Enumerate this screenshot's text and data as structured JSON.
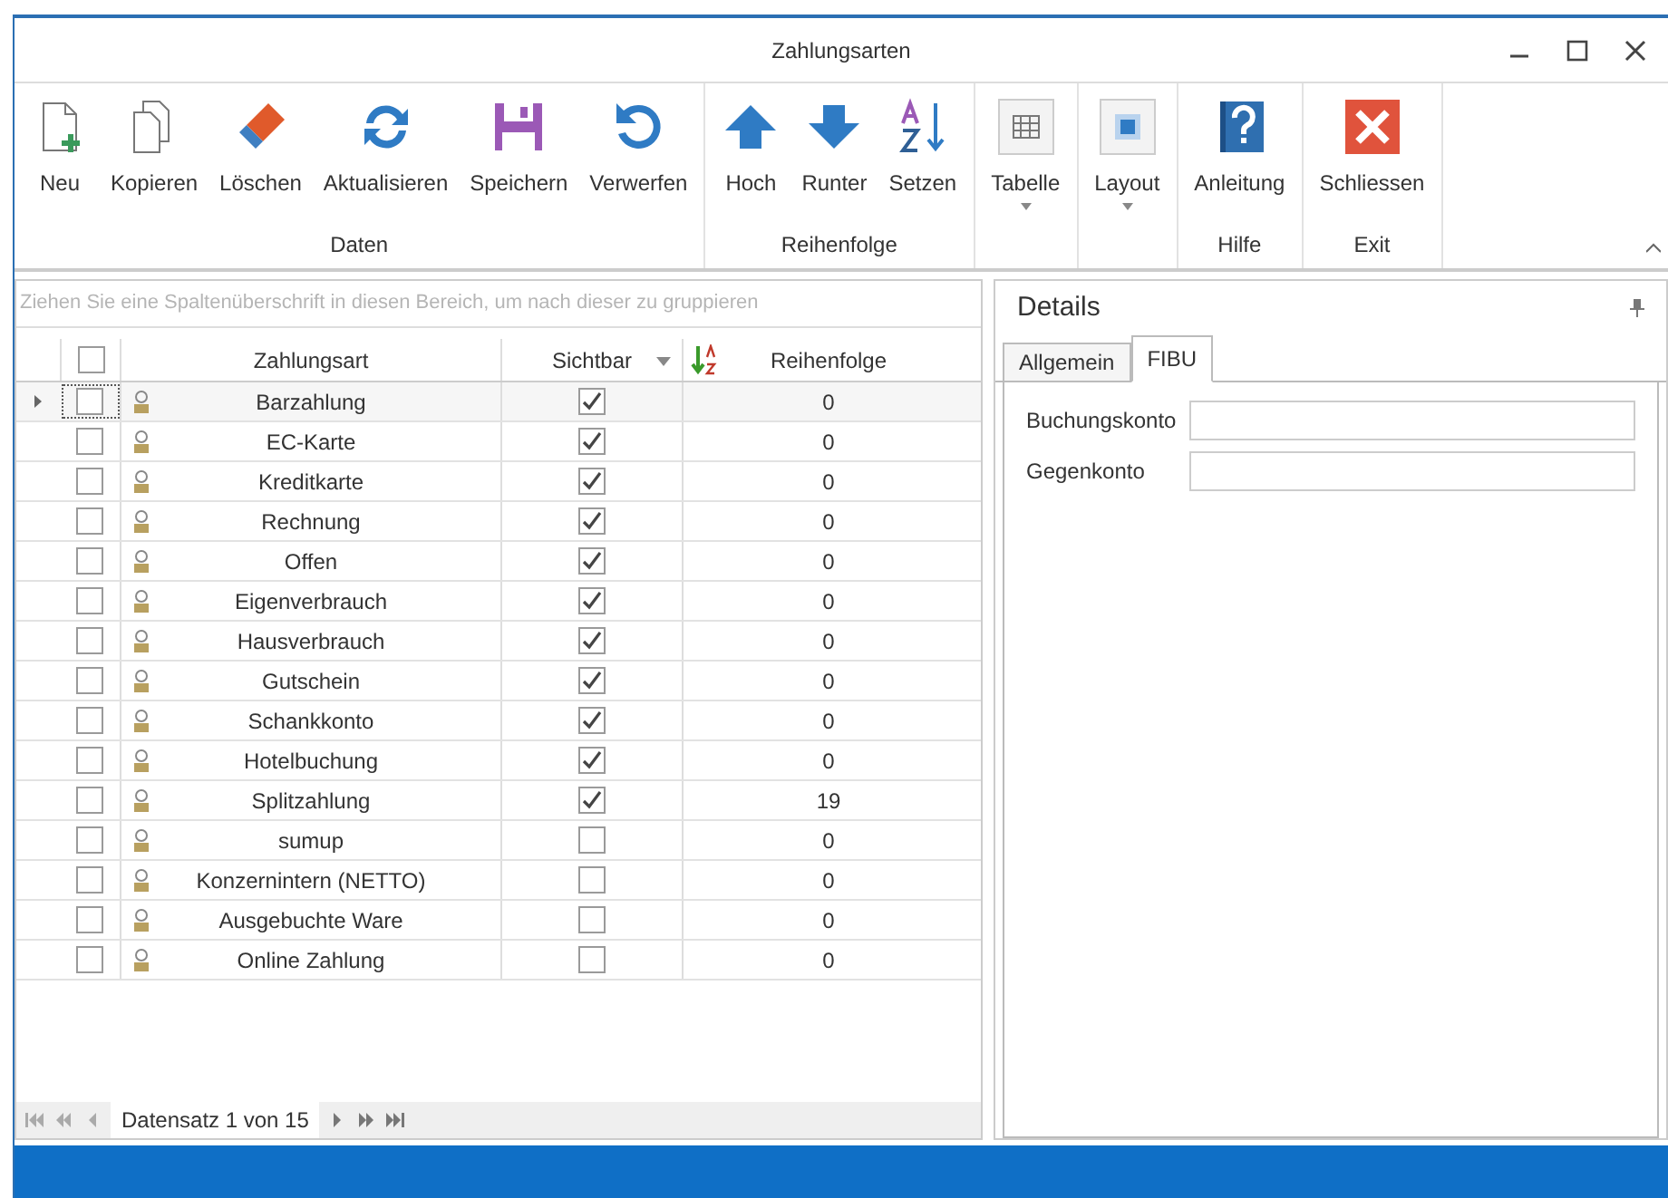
{
  "window": {
    "title": "Zahlungsarten"
  },
  "ribbon": [
    {
      "label": "Daten",
      "buttons": [
        {
          "label": "Neu"
        },
        {
          "label": "Kopieren"
        },
        {
          "label": "Löschen"
        },
        {
          "label": "Aktualisieren"
        },
        {
          "label": "Speichern"
        },
        {
          "label": "Verwerfen"
        }
      ]
    },
    {
      "label": "Reihenfolge",
      "buttons": [
        {
          "label": "Hoch"
        },
        {
          "label": "Runter"
        },
        {
          "label": "Setzen"
        }
      ]
    },
    {
      "buttons": [
        {
          "label": "Tabelle",
          "dropdown": true
        }
      ]
    },
    {
      "buttons": [
        {
          "label": "Layout",
          "dropdown": true
        }
      ]
    },
    {
      "label": "Hilfe",
      "buttons": [
        {
          "label": "Anleitung"
        }
      ]
    },
    {
      "label": "Exit",
      "buttons": [
        {
          "label": "Schliessen"
        }
      ]
    }
  ],
  "group_panel": {
    "hint": "Ziehen Sie eine Spaltenüberschrift in diesen Bereich, um nach dieser zu gruppieren"
  },
  "table": {
    "columns": [
      "Zahlungsart",
      "Sichtbar",
      "Reihenfolge"
    ],
    "all_checked": false,
    "rows": [
      {
        "checked": false,
        "selected": true,
        "name": "Barzahlung",
        "visible": true,
        "order": "0"
      },
      {
        "checked": false,
        "selected": false,
        "name": "EC-Karte",
        "visible": true,
        "order": "0"
      },
      {
        "checked": false,
        "selected": false,
        "name": "Kreditkarte",
        "visible": true,
        "order": "0"
      },
      {
        "checked": false,
        "selected": false,
        "name": "Rechnung",
        "visible": true,
        "order": "0"
      },
      {
        "checked": false,
        "selected": false,
        "name": "Offen",
        "visible": true,
        "order": "0"
      },
      {
        "checked": false,
        "selected": false,
        "name": "Eigenverbrauch",
        "visible": true,
        "order": "0"
      },
      {
        "checked": false,
        "selected": false,
        "name": "Hausverbrauch",
        "visible": true,
        "order": "0"
      },
      {
        "checked": false,
        "selected": false,
        "name": "Gutschein",
        "visible": true,
        "order": "0"
      },
      {
        "checked": false,
        "selected": false,
        "name": "Schankkonto",
        "visible": true,
        "order": "0"
      },
      {
        "checked": false,
        "selected": false,
        "name": "Hotelbuchung",
        "visible": true,
        "order": "0"
      },
      {
        "checked": false,
        "selected": false,
        "name": "Splitzahlung",
        "visible": true,
        "order": "19"
      },
      {
        "checked": false,
        "selected": false,
        "name": "sumup",
        "visible": false,
        "order": "0"
      },
      {
        "checked": false,
        "selected": false,
        "name": "Konzernintern (NETTO)",
        "visible": false,
        "order": "0"
      },
      {
        "checked": false,
        "selected": false,
        "name": "Ausgebuchte Ware",
        "visible": false,
        "order": "0"
      },
      {
        "checked": false,
        "selected": false,
        "name": "Online Zahlung",
        "visible": false,
        "order": "0"
      }
    ]
  },
  "navigator": {
    "text": "Datensatz 1 von 15"
  },
  "details": {
    "title": "Details",
    "tabs": [
      {
        "label": "Allgemein",
        "selected": false
      },
      {
        "label": "FIBU",
        "selected": true
      }
    ],
    "fields": [
      {
        "label": "Buchungskonto"
      },
      {
        "label": "Gegenkonto"
      }
    ]
  }
}
